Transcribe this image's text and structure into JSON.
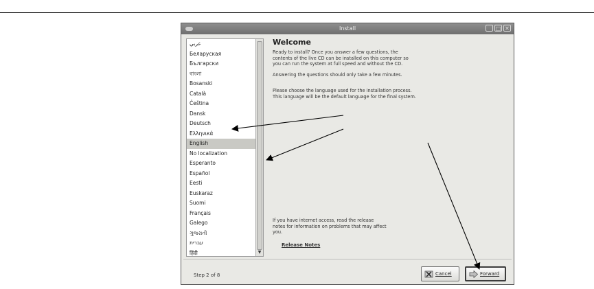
{
  "window": {
    "title": "Install",
    "controls": [
      "_",
      "□",
      "✕"
    ]
  },
  "language_list": {
    "items": [
      "عربي",
      "Беларуская",
      "Български",
      "বাংলা",
      "Bosanski",
      "Català",
      "Čeština",
      "Dansk",
      "Deutsch",
      "Ελληνικά",
      "English",
      "No localization",
      "Esperanto",
      "Español",
      "Eesti",
      "Euskaraz",
      "Suomi",
      "Français",
      "Galego",
      "ગુજરાતી",
      "עברית",
      "हिंदी"
    ],
    "selected_index": 10
  },
  "content": {
    "heading": "Welcome",
    "paragraph1": "Ready to install? Once you answer a few questions, the\ncontents of the live CD can be installed on this computer so\nyou can run the system at full speed and without the CD.",
    "paragraph2": "Answering the questions should only take a few minutes.",
    "paragraph3": "Please choose the language used for the installation process.\nThis language will be the default language for the final system.",
    "paragraph4": "If you have internet access, read the release\nnotes for information on problems that may affect\nyou.",
    "release_notes": "Release Notes"
  },
  "footer": {
    "step": "Step 2 of 8",
    "cancel_label": "Cancel",
    "forward_label": "Forward"
  },
  "icons": {
    "cancel": "cancel-icon",
    "forward": "forward-arrow-icon"
  }
}
